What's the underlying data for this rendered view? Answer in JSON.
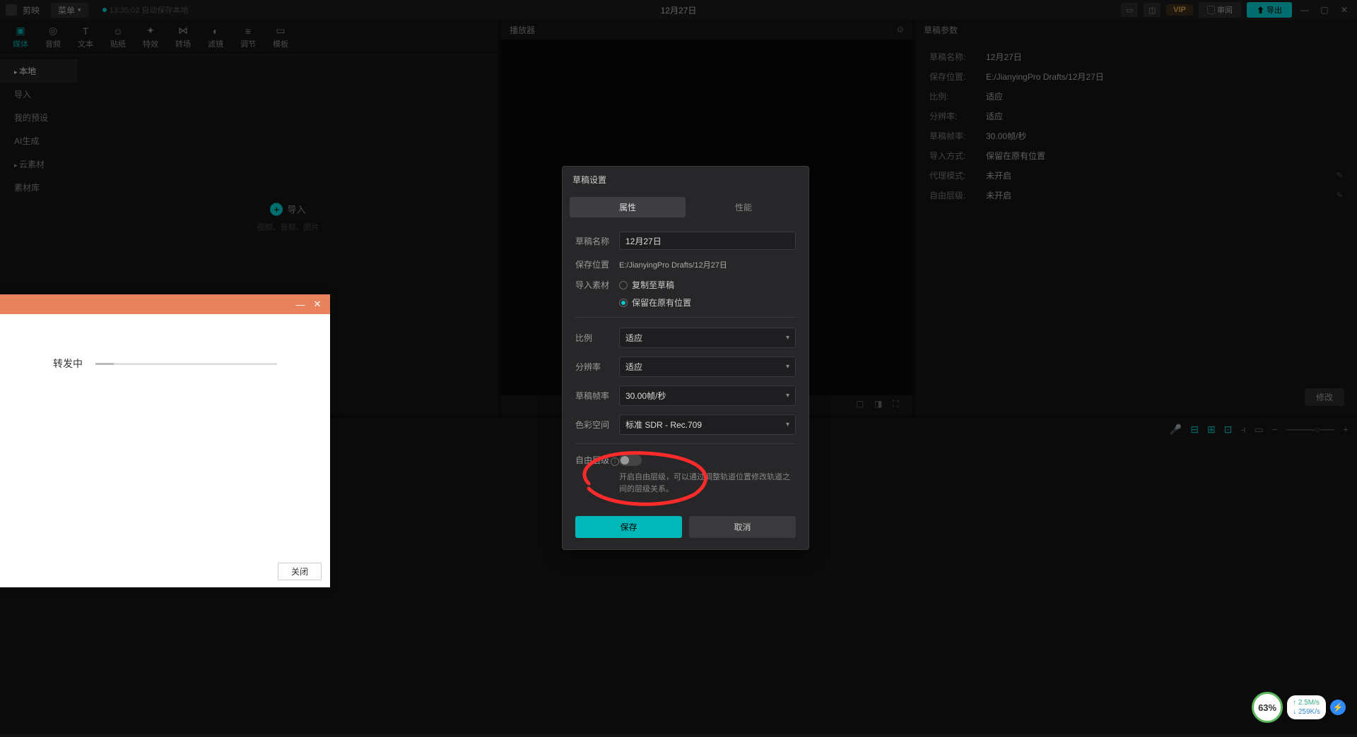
{
  "titlebar": {
    "app_name": "剪映",
    "menu": "菜单",
    "save_status": "13:35:02 自动保存本地",
    "project_title": "12月27日",
    "vip": "VIP",
    "review": "审阅",
    "export": "导出"
  },
  "tool_tabs": [
    {
      "label": "媒体",
      "icon": "▣"
    },
    {
      "label": "音频",
      "icon": "◎"
    },
    {
      "label": "文本",
      "icon": "T"
    },
    {
      "label": "贴纸",
      "icon": "☺"
    },
    {
      "label": "特效",
      "icon": "✦"
    },
    {
      "label": "转场",
      "icon": "⋈"
    },
    {
      "label": "滤镜",
      "icon": "◐"
    },
    {
      "label": "调节",
      "icon": "≡"
    },
    {
      "label": "模板",
      "icon": "▭"
    }
  ],
  "sidebar": {
    "items": [
      "本地",
      "导入",
      "我的预设",
      "AI生成",
      "云素材",
      "素材库"
    ]
  },
  "import": {
    "label": "导入",
    "hint": "视频、音频、图片"
  },
  "center": {
    "title": "播放器"
  },
  "right": {
    "title": "草稿参数",
    "rows": [
      {
        "label": "草稿名称:",
        "value": "12月27日"
      },
      {
        "label": "保存位置:",
        "value": "E:/JianyingPro Drafts/12月27日"
      },
      {
        "label": "比例:",
        "value": "适应"
      },
      {
        "label": "分辨率:",
        "value": "适应"
      },
      {
        "label": "草稿帧率:",
        "value": "30.00帧/秒"
      },
      {
        "label": "导入方式:",
        "value": "保留在原有位置"
      },
      {
        "label": "代理模式:",
        "value": "未开启"
      },
      {
        "label": "自由层级:",
        "value": "未开启"
      }
    ],
    "modify": "修改"
  },
  "modal": {
    "title": "草稿设置",
    "tabs": [
      "属性",
      "性能"
    ],
    "name_label": "草稿名称",
    "name_value": "12月27日",
    "save_label": "保存位置",
    "save_value": "E:/JianyingPro Drafts/12月27日",
    "import_label": "导入素材",
    "import_options": [
      "复制至草稿",
      "保留在原有位置"
    ],
    "ratio_label": "比例",
    "ratio_value": "适应",
    "res_label": "分辨率",
    "res_value": "适应",
    "fps_label": "草稿帧率",
    "fps_value": "30.00帧/秒",
    "color_label": "色彩空间",
    "color_value": "标准 SDR - Rec.709",
    "layer_label": "自由层级",
    "layer_desc": "开启自由层级，可以通过调整轨道位置修改轨道之间的层级关系。",
    "save_btn": "保存",
    "cancel_btn": "取消"
  },
  "forward_popup": {
    "text": "转发中",
    "close_btn": "关闭"
  },
  "net": {
    "percent": "63%",
    "up": "2.5M/s",
    "down": "259K/s"
  }
}
